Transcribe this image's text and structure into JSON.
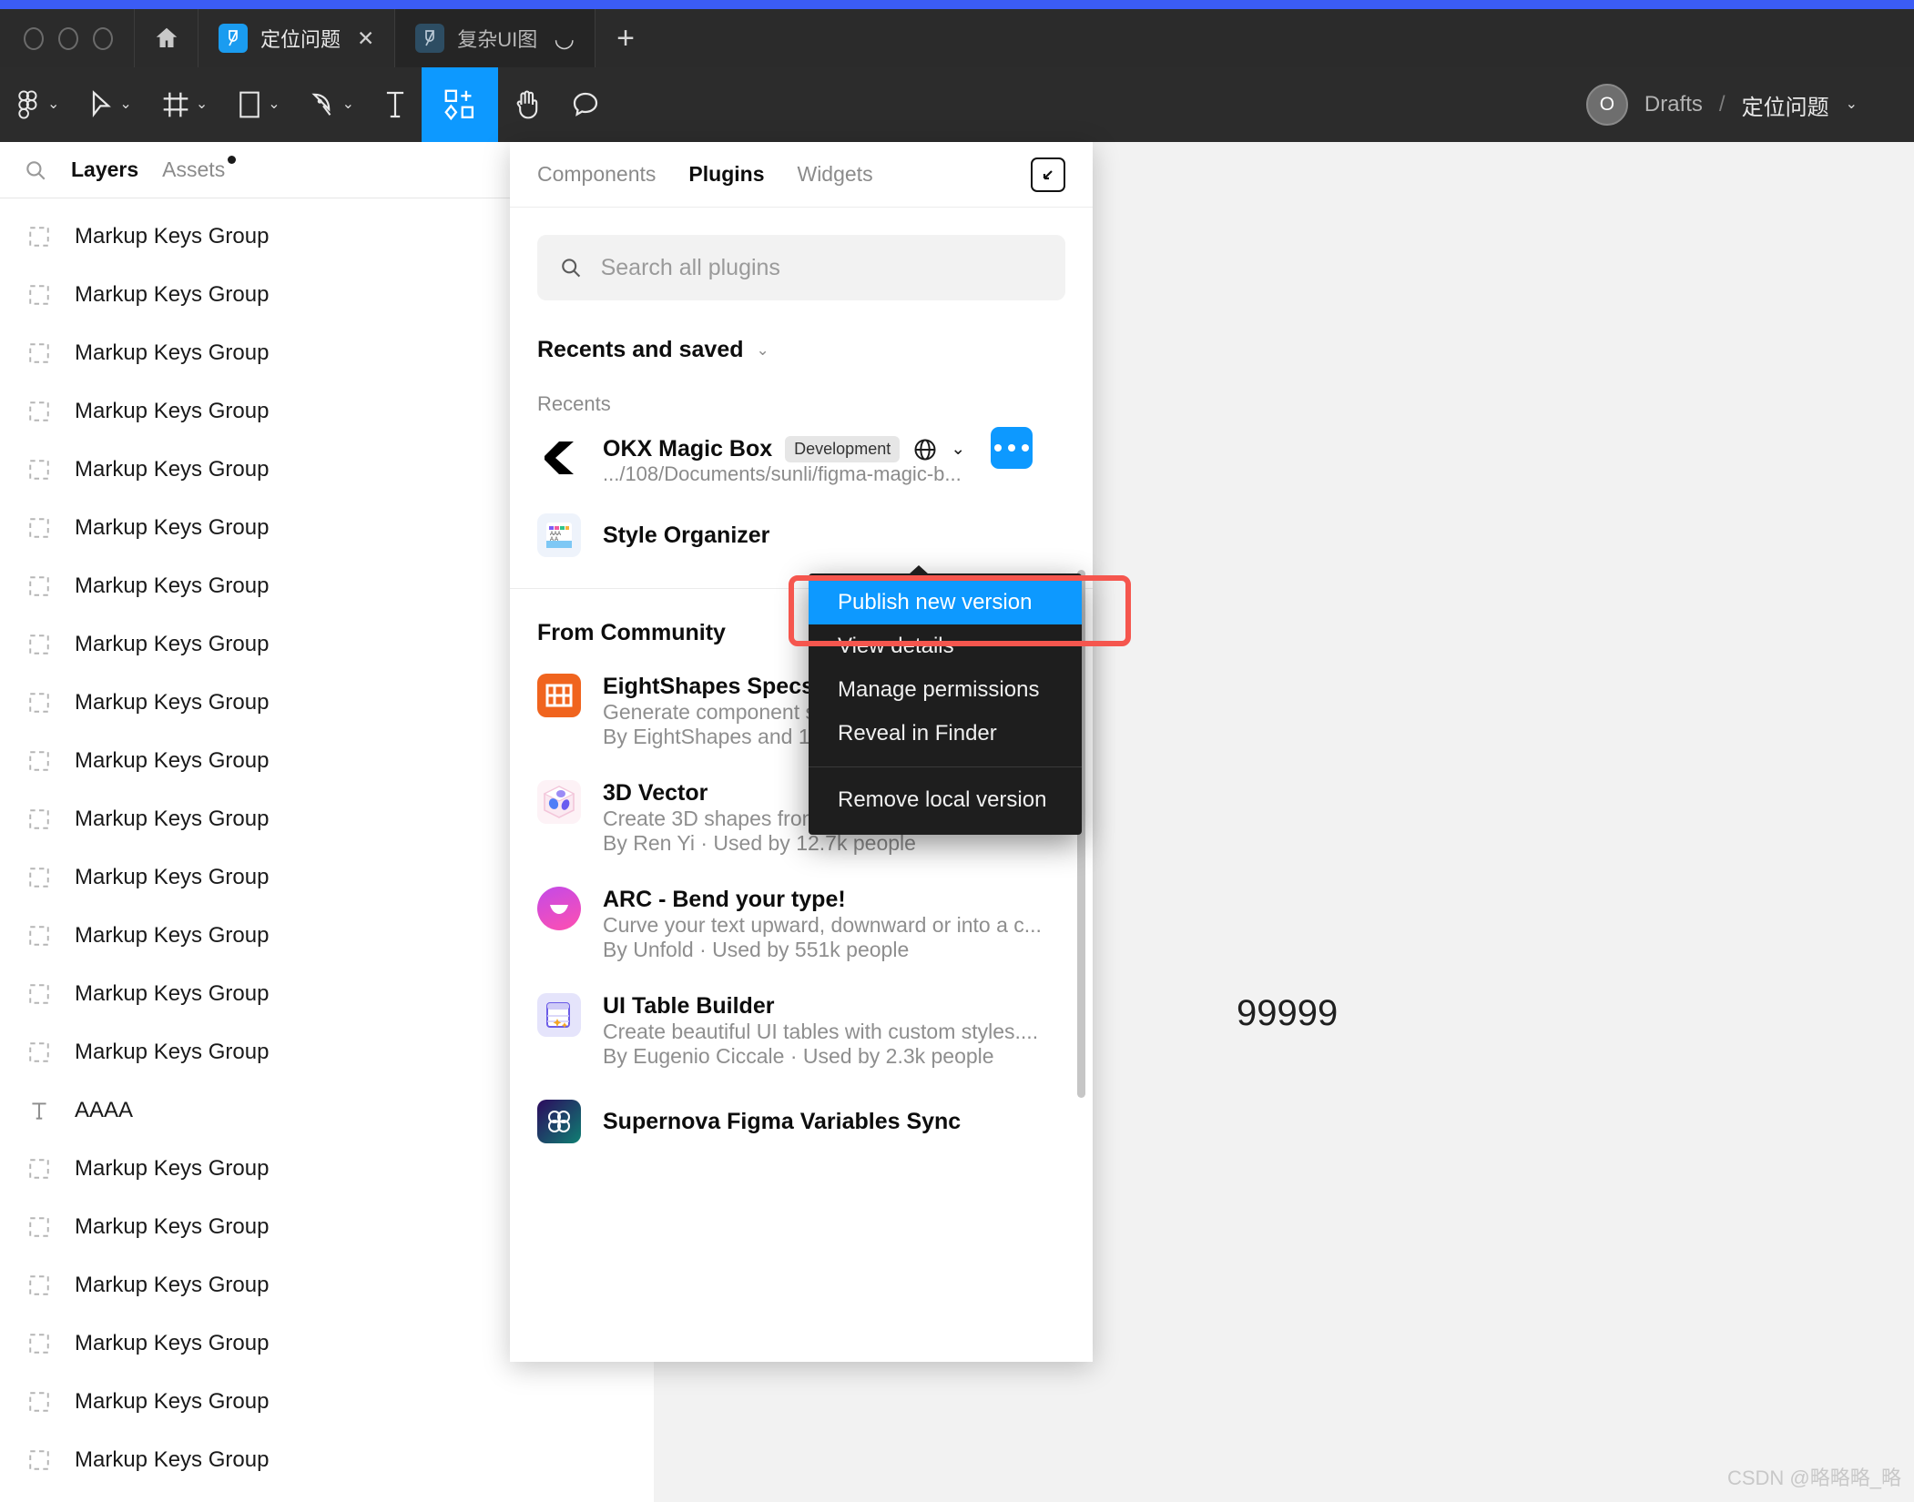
{
  "window": {
    "traffic_lights": [
      "close",
      "minimize",
      "maximize"
    ],
    "home_icon": "home-icon",
    "new_tab_label": "+",
    "tabs": [
      {
        "label": "定位问题",
        "icon": "figma-file-icon",
        "active": true,
        "close_label": "✕"
      },
      {
        "label": "复杂UI图",
        "icon": "figma-file-icon",
        "active": false,
        "spinner": "◡"
      }
    ]
  },
  "toolbar": {
    "tools": [
      {
        "name": "figma-menu-icon",
        "caret": "⌄"
      },
      {
        "name": "move-cursor-icon",
        "caret": "⌄"
      },
      {
        "name": "frame-icon",
        "caret": "⌄"
      },
      {
        "name": "shape-rectangle-icon",
        "caret": "⌄"
      },
      {
        "name": "pen-icon",
        "caret": "⌄"
      },
      {
        "name": "text-tool-icon",
        "caret": ""
      },
      {
        "name": "resources-plugins-icon",
        "caret": "",
        "selected": true
      },
      {
        "name": "hand-tool-icon",
        "caret": ""
      },
      {
        "name": "comment-icon",
        "caret": ""
      }
    ],
    "accent_color": "#0d99ff",
    "avatar_initial": "O",
    "breadcrumb_project": "Drafts",
    "breadcrumb_sep": "/",
    "breadcrumb_file": "定位问题",
    "breadcrumb_caret": "⌄"
  },
  "left_panel": {
    "search_icon": "search-icon",
    "tabs": [
      {
        "label": "Layers",
        "active": true
      },
      {
        "label": "Assets",
        "active": false,
        "has_dot": true
      }
    ],
    "layers": [
      {
        "label": "Markup Keys Group",
        "type": "group"
      },
      {
        "label": "Markup Keys Group",
        "type": "group"
      },
      {
        "label": "Markup Keys Group",
        "type": "group"
      },
      {
        "label": "Markup Keys Group",
        "type": "group"
      },
      {
        "label": "Markup Keys Group",
        "type": "group"
      },
      {
        "label": "Markup Keys Group",
        "type": "group"
      },
      {
        "label": "Markup Keys Group",
        "type": "group"
      },
      {
        "label": "Markup Keys Group",
        "type": "group"
      },
      {
        "label": "Markup Keys Group",
        "type": "group"
      },
      {
        "label": "Markup Keys Group",
        "type": "group"
      },
      {
        "label": "Markup Keys Group",
        "type": "group"
      },
      {
        "label": "Markup Keys Group",
        "type": "group"
      },
      {
        "label": "Markup Keys Group",
        "type": "group"
      },
      {
        "label": "Markup Keys Group",
        "type": "group"
      },
      {
        "label": "Markup Keys Group",
        "type": "group"
      },
      {
        "label": "AAAA",
        "type": "text"
      },
      {
        "label": "Markup Keys Group",
        "type": "group"
      },
      {
        "label": "Markup Keys Group",
        "type": "group"
      },
      {
        "label": "Markup Keys Group",
        "type": "group"
      },
      {
        "label": "Markup Keys Group",
        "type": "group"
      },
      {
        "label": "Markup Keys Group",
        "type": "group"
      },
      {
        "label": "Markup Keys Group",
        "type": "group"
      }
    ]
  },
  "canvas": {
    "text_node": "99999",
    "watermark": "CSDN @略略略_略"
  },
  "plugins_panel": {
    "tabs": [
      {
        "label": "Components",
        "active": false
      },
      {
        "label": "Plugins",
        "active": true
      },
      {
        "label": "Widgets",
        "active": false
      }
    ],
    "popout_icon": "popout-arrow-icon",
    "search": {
      "icon": "search-icon",
      "value": "",
      "placeholder": "Search all plugins"
    },
    "recents_and_saved": {
      "label": "Recents and saved",
      "caret": "⌄"
    },
    "recents_label": "Recents",
    "recents": [
      {
        "name": "OKX Magic Box",
        "badge": "Development",
        "globe_icon": "globe-icon",
        "caret": "⌄",
        "path": ".../108/Documents/sunli/figma-magic-b...",
        "more_button": "more-options-button",
        "icon_name": "okx-logo-icon"
      },
      {
        "name": "Style Organizer",
        "icon_name": "style-organizer-icon"
      }
    ],
    "community_label": "From Community",
    "community": [
      {
        "name": "EightShapes Specs",
        "desc": "Generate component specs including anatom...",
        "meta": "By EightShapes and 1 others · Used by 67k peop",
        "icon_name": "eightshapes-specs-icon"
      },
      {
        "name": "3D Vector",
        "desc": "Create 3D shapes from paths, texts, polygons...",
        "meta": "By Ren Yi · Used by 12.7k people",
        "icon_name": "3d-vector-icon"
      },
      {
        "name": "ARC - Bend your type!",
        "desc": "Curve your text upward, downward or into a c...",
        "meta": "By Unfold · Used by 551k people",
        "icon_name": "arc-bend-type-icon"
      },
      {
        "name": "UI Table Builder",
        "desc": "Create beautiful UI tables with custom styles....",
        "meta": "By Eugenio Ciccale · Used by 2.3k people",
        "icon_name": "ui-table-builder-icon"
      },
      {
        "name": "Supernova Figma Variables Sync",
        "desc": "",
        "meta": "",
        "icon_name": "supernova-sync-icon"
      }
    ]
  },
  "context_menu": {
    "items": [
      {
        "label": "Publish new version",
        "highlighted": true
      },
      {
        "label": "View details",
        "highlighted": false
      },
      {
        "label": "Manage permissions",
        "highlighted": false
      },
      {
        "label": "Reveal in Finder",
        "highlighted": false
      },
      {
        "separator": true
      },
      {
        "label": "Remove local version",
        "highlighted": false
      }
    ],
    "highlight_color": "#0d99ff",
    "annotation_box_color": "#f5564e"
  }
}
